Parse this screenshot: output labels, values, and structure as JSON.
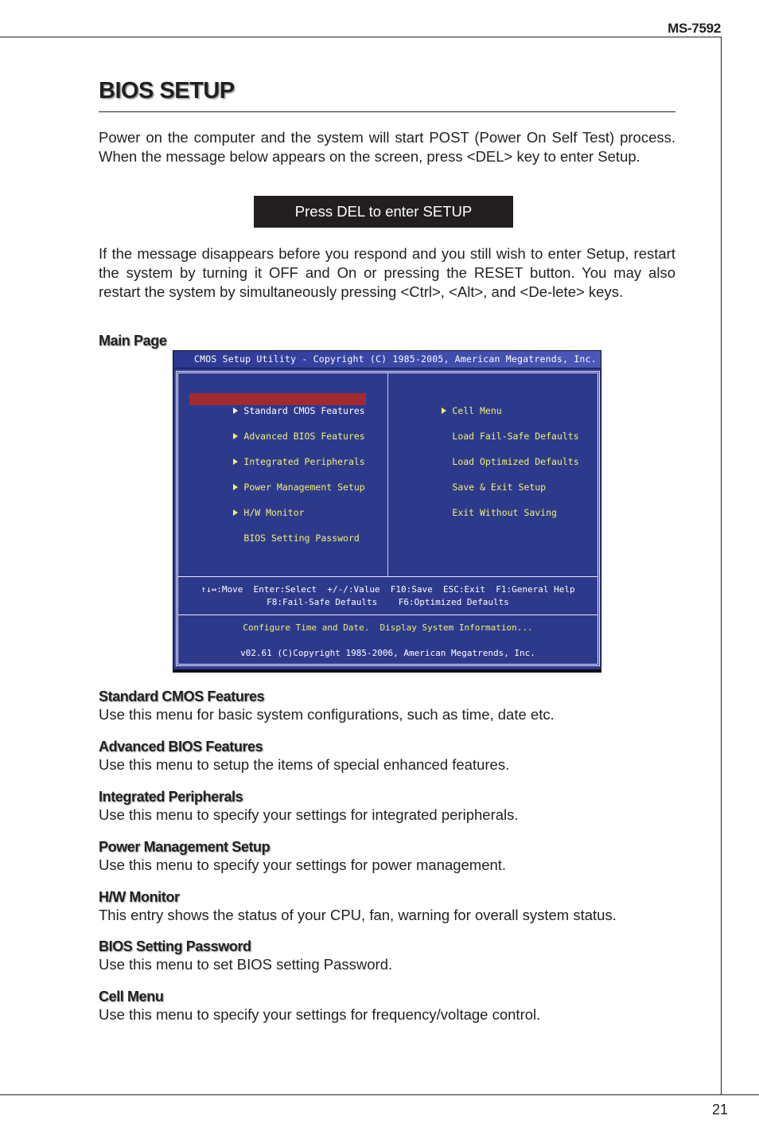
{
  "header": {
    "model": "MS-7592"
  },
  "page_title": "BIOS SETUP",
  "intro_paragraph": "Power on the computer and the system will start POST (Power On Self Test) process. When the message below appears on the screen, press <DEL> key to enter Setup.",
  "del_message": "Press DEL to enter SETUP",
  "restart_paragraph": "If the message disappears before you respond and you still wish to enter Setup, restart the system by turning it OFF and On or pressing the RESET button. You may also restart the system by simultaneously pressing <Ctrl>, <Alt>, and <De-lete> keys.",
  "main_page_label": "Main Page",
  "bios_screen": {
    "title": "CMOS Setup Utility - Copyright (C) 1985-2005, American Megatrends, Inc.",
    "left_menu": [
      {
        "label": "Standard CMOS Features",
        "arrow": true,
        "selected": true
      },
      {
        "label": "Advanced BIOS Features",
        "arrow": true,
        "selected": false
      },
      {
        "label": "Integrated Peripherals",
        "arrow": true,
        "selected": false
      },
      {
        "label": "Power Management Setup",
        "arrow": true,
        "selected": false
      },
      {
        "label": "H/W Monitor",
        "arrow": true,
        "selected": false
      },
      {
        "label": "BIOS Setting Password",
        "arrow": false,
        "selected": false
      }
    ],
    "right_menu": [
      {
        "label": "Cell Menu",
        "arrow": true
      },
      {
        "label": "Load Fail-Safe Defaults",
        "arrow": false
      },
      {
        "label": "Load Optimized Defaults",
        "arrow": false
      },
      {
        "label": "Save & Exit Setup",
        "arrow": false
      },
      {
        "label": "Exit Without Saving",
        "arrow": false
      }
    ],
    "help_line1": "↑↓↔:Move  Enter:Select  +/-/:Value  F10:Save  ESC:Exit  F1:General Help",
    "help_line2": "F8:Fail-Safe Defaults    F6:Optimized Defaults",
    "item_description": "Configure Time and Date.  Display System Information...",
    "version": "v02.61 (C)Copyright 1985-2006, American Megatrends, Inc.",
    "colors": {
      "background": "#2d3a8c",
      "menu_text": "#f0f070",
      "selected_bg": "#a12a30"
    }
  },
  "sections": [
    {
      "heading": "Standard CMOS Features",
      "body": "Use this menu for basic system configurations, such as time, date etc."
    },
    {
      "heading": "Advanced BIOS Features",
      "body": "Use this menu to setup the items of special enhanced features."
    },
    {
      "heading": "Integrated Peripherals",
      "body": "Use this menu to specify your settings for integrated peripherals."
    },
    {
      "heading": "Power Management Setup",
      "body": "Use this menu to specify your settings for power management."
    },
    {
      "heading": "H/W Monitor",
      "body": "This entry shows the status of your CPU, fan, warning for overall system status."
    },
    {
      "heading": "BIOS Setting Password",
      "body": "Use this menu to set BIOS setting Password."
    },
    {
      "heading": "Cell Menu",
      "body": "Use this menu to specify your settings for frequency/voltage control."
    }
  ],
  "footer": {
    "page_number": "21"
  }
}
